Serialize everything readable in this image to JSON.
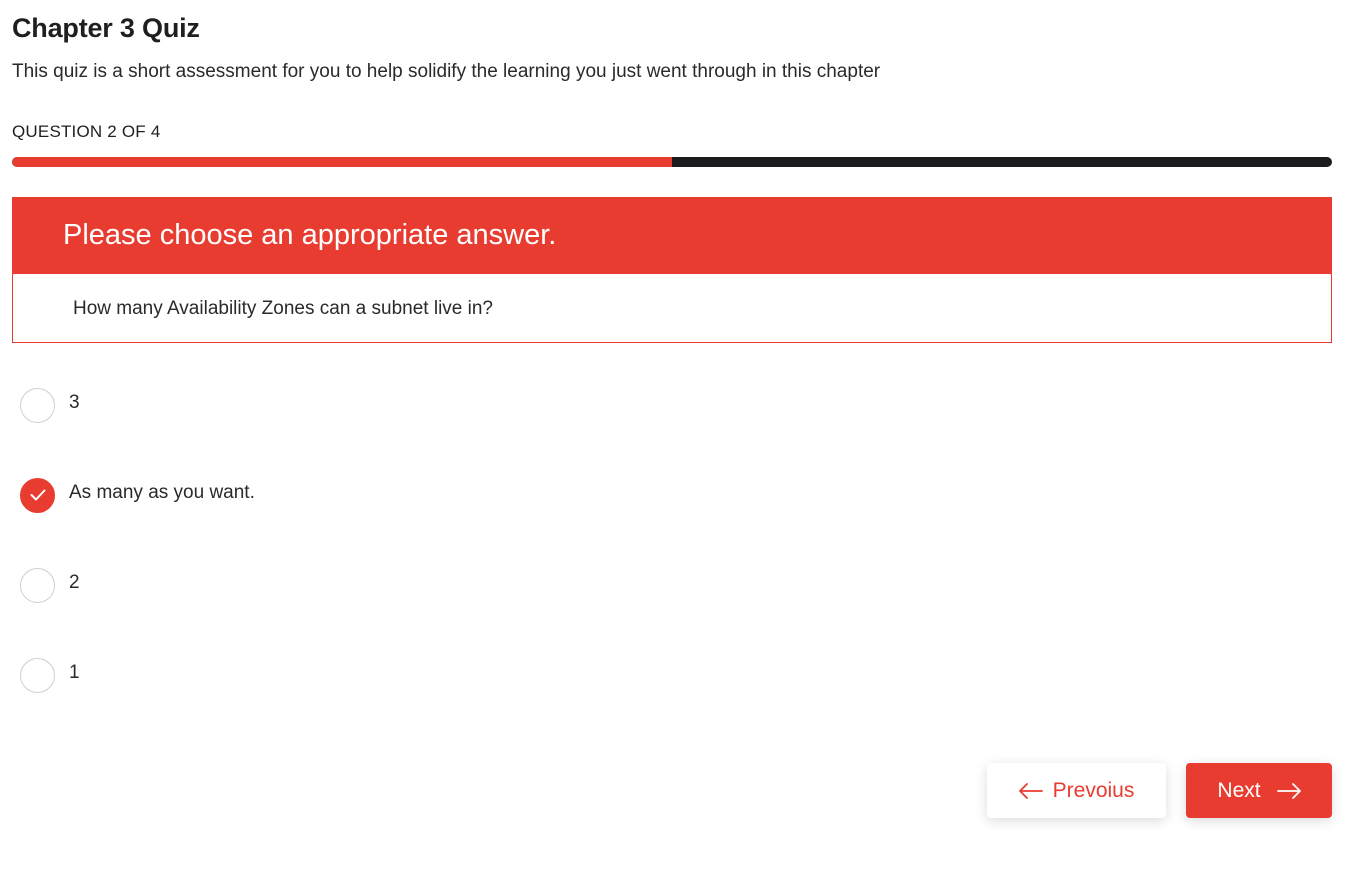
{
  "quiz": {
    "title": "Chapter 3 Quiz",
    "description": "This quiz is a short assessment for you to help solidify the learning you just went through in this chapter",
    "counter": "QUESTION 2 OF 4",
    "progress_fraction": 0.5
  },
  "question": {
    "prompt_header": "Please choose an appropriate answer.",
    "text": "How many Availability Zones can a subnet live in?"
  },
  "options": [
    {
      "label": "3",
      "selected": false
    },
    {
      "label": "As many as you want.",
      "selected": true
    },
    {
      "label": "2",
      "selected": false
    },
    {
      "label": "1",
      "selected": false
    }
  ],
  "nav": {
    "previous_label": "Prevoius",
    "previous_icon": "arrow-left-icon",
    "next_label": "Next",
    "next_icon": "arrow-right-icon"
  },
  "colors": {
    "accent": "#e83c31",
    "track": "#1c1c1e"
  }
}
